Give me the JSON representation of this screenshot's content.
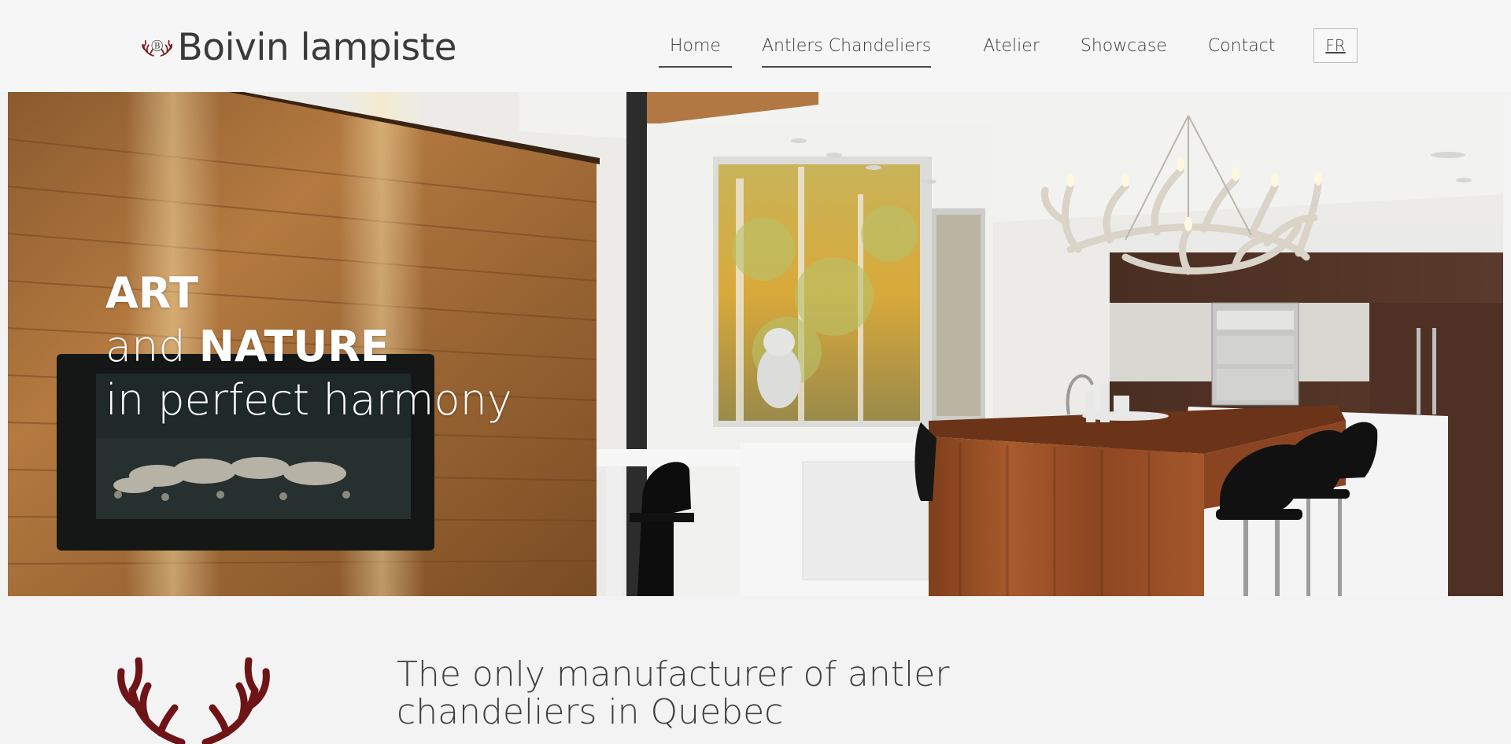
{
  "brand": {
    "logo_mark": "antler-b-logo",
    "name": "Boivin lampiste",
    "accent_color": "#7a1a1d"
  },
  "nav": {
    "items": [
      {
        "label": "Home",
        "active": true
      },
      {
        "label": "Antlers Chandeliers",
        "active": false
      },
      {
        "label": "Atelier",
        "active": false
      },
      {
        "label": "Showcase",
        "active": false
      },
      {
        "label": "Contact",
        "active": false
      }
    ],
    "language_toggle": "FR"
  },
  "hero": {
    "line1_bold": "ART",
    "line2_prefix": "and ",
    "line2_bold": "NATURE",
    "line3": "in perfect harmony"
  },
  "intro": {
    "icon": "antlers-icon",
    "tagline_line1": "The only manufacturer of antler",
    "tagline_line2": "chandeliers in Quebec"
  }
}
